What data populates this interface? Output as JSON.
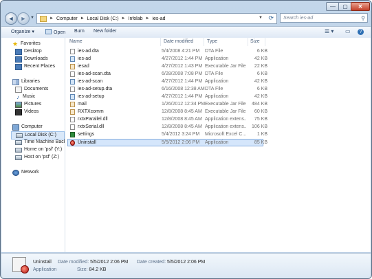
{
  "window": {
    "controls": {
      "minimize": "—",
      "maximize": "▢",
      "close": "✕"
    }
  },
  "nav": {
    "back_glyph": "◄",
    "forward_glyph": "►",
    "breadcrumb": [
      "Computer",
      "Local Disk (C:)",
      "Infolab",
      "ies-ad"
    ],
    "search_placeholder": "Search ies-ad"
  },
  "toolbar": {
    "organize": "Organize ▾",
    "open": "Open",
    "burn": "Burn",
    "new_folder": "New folder"
  },
  "sidebar": {
    "favorites": "Favorites",
    "desktop": "Desktop",
    "downloads": "Downloads",
    "recent": "Recent Places",
    "libraries": "Libraries",
    "documents": "Documents",
    "music": "Music",
    "pictures": "Pictures",
    "videos": "Videos",
    "computer": "Computer",
    "local_disk": "Local Disk (C:)",
    "time_machine": "Time Machine Backu",
    "home_psf": "Home on 'psf' (Y:)",
    "host_psf": "Host on 'psf' (Z:)",
    "network": "Network"
  },
  "columns": {
    "name": "Name",
    "date": "Date modified",
    "type": "Type",
    "size": "Size"
  },
  "files": [
    {
      "name": "ies-ad.dta",
      "date": "5/4/2008 4:21 PM",
      "type": "DTA File",
      "size": "6 KB",
      "icon": "dta"
    },
    {
      "name": "ies-ad",
      "date": "4/27/2012 1:44 PM",
      "type": "Application",
      "size": "42 KB",
      "icon": "app"
    },
    {
      "name": "iesad",
      "date": "4/27/2012 1:43 PM",
      "type": "Executable Jar File",
      "size": "22 KB",
      "icon": "jar"
    },
    {
      "name": "ies-ad-scan.dta",
      "date": "6/28/2008 7:08 PM",
      "type": "DTA File",
      "size": "6 KB",
      "icon": "dta"
    },
    {
      "name": "ies-ad-scan",
      "date": "4/27/2012 1:44 PM",
      "type": "Application",
      "size": "42 KB",
      "icon": "app"
    },
    {
      "name": "ies-ad-setup.dta",
      "date": "6/16/2008 12:38 AM",
      "type": "DTA File",
      "size": "6 KB",
      "icon": "dta"
    },
    {
      "name": "ies-ad-setup",
      "date": "4/27/2012 1:44 PM",
      "type": "Application",
      "size": "42 KB",
      "icon": "app"
    },
    {
      "name": "mail",
      "date": "1/26/2012 12:34 PM",
      "type": "Executable Jar File",
      "size": "484 KB",
      "icon": "jar"
    },
    {
      "name": "RXTXcomm",
      "date": "12/8/2008 8:45 AM",
      "type": "Executable Jar File",
      "size": "60 KB",
      "icon": "jar"
    },
    {
      "name": "rxtxParallel.dll",
      "date": "12/8/2008 8:45 AM",
      "type": "Application extens...",
      "size": "75 KB",
      "icon": "dll"
    },
    {
      "name": "rxtxSerial.dll",
      "date": "12/8/2008 8:45 AM",
      "type": "Application extens...",
      "size": "106 KB",
      "icon": "dll"
    },
    {
      "name": "settings",
      "date": "5/4/2012 3:24 PM",
      "type": "Microsoft Excel C...",
      "size": "1 KB",
      "icon": "excel"
    },
    {
      "name": "Uninstall",
      "date": "5/5/2012 2:06 PM",
      "type": "Application",
      "size": "85 KB",
      "icon": "uninstall",
      "selected": true
    }
  ],
  "details": {
    "name": "Uninstall",
    "type": "Application",
    "date_modified_label": "Date modified:",
    "date_modified": "5/5/2012 2:06 PM",
    "size_label": "Size:",
    "size": "84.2 KB",
    "date_created_label": "Date created:",
    "date_created": "5/5/2012 2:06 PM"
  }
}
